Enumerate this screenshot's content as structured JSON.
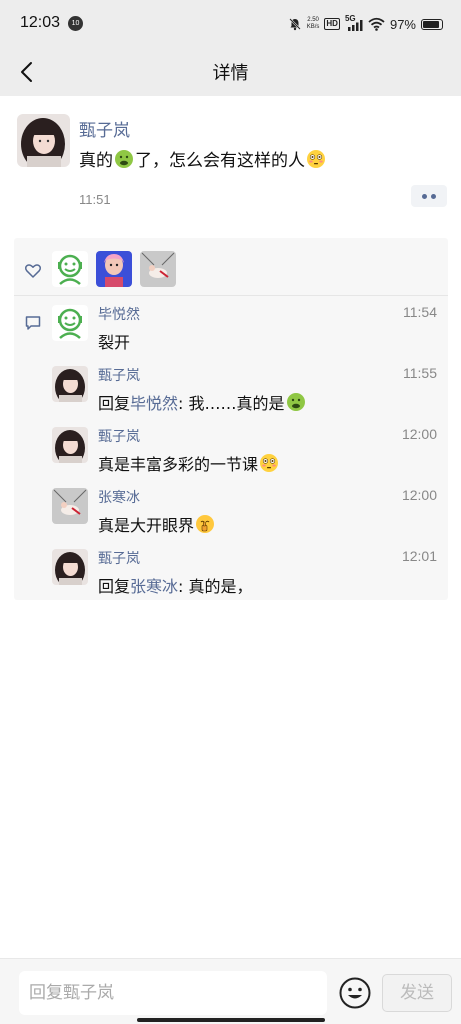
{
  "status_bar": {
    "time": "12:03",
    "notification_badge": "10",
    "net_speed_value": "2.50",
    "net_speed_unit": "KB/s",
    "hd_label": "HD",
    "network_label": "5G",
    "battery_text": "97%"
  },
  "header": {
    "title": "详情"
  },
  "post": {
    "author": "甄子岚",
    "text_part1": "真的",
    "text_part2": "了，怎么会有这样的人",
    "time": "11:51",
    "emoji1": "nauseated-emoji",
    "emoji2": "flushed-emoji"
  },
  "likes": {
    "icon": "heart-outline-icon",
    "users": [
      {
        "name": "green-smiley-avatar"
      },
      {
        "name": "cartoon-character-avatar"
      },
      {
        "name": "illustration-avatar"
      }
    ]
  },
  "comments": [
    {
      "author": "毕悦然",
      "time": "11:54",
      "text": "裂开"
    },
    {
      "author": "甄子岚",
      "time": "11:55",
      "reply_prefix": "回复",
      "reply_to": "毕悦然",
      "text": ": 我……真的是"
    },
    {
      "author": "甄子岚",
      "time": "12:00",
      "text": "真是丰富多彩的一节课"
    },
    {
      "author": "张寒冰",
      "time": "12:00",
      "text": "真是大开眼界"
    },
    {
      "author": "甄子岚",
      "time": "12:01",
      "reply_prefix": "回复",
      "reply_to": "张寒冰",
      "text": ": 真的是，"
    }
  ],
  "input": {
    "placeholder": "回复甄子岚",
    "send_label": "发送"
  },
  "colors": {
    "link": "#576b95",
    "header_bg": "#ededed",
    "comment_bg": "#f7f7f7"
  }
}
